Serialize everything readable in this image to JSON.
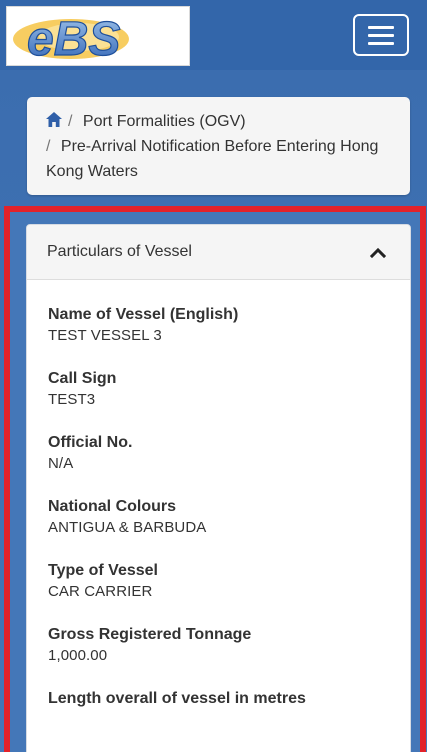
{
  "header": {
    "logo_text": "eBS",
    "menu_button": "toggle-navigation"
  },
  "breadcrumb": {
    "items": [
      "Port Formalities (OGV)",
      "Pre-Arrival Notification Before Entering Hong Kong Waters"
    ]
  },
  "panel": {
    "title": "Particulars of Vessel",
    "fields": [
      {
        "label": "Name of Vessel (English)",
        "value": "TEST VESSEL 3"
      },
      {
        "label": "Call Sign",
        "value": "TEST3"
      },
      {
        "label": "Official No.",
        "value": "N/A"
      },
      {
        "label": "National Colours",
        "value": "ANTIGUA & BARBUDA"
      },
      {
        "label": "Type of Vessel",
        "value": "CAR CARRIER"
      },
      {
        "label": "Gross Registered Tonnage",
        "value": "1,000.00"
      },
      {
        "label": "Length overall of vessel in metres",
        "value": ""
      }
    ]
  },
  "colors": {
    "brand_blue": "#3366aa",
    "highlight_red": "#e2222a"
  }
}
